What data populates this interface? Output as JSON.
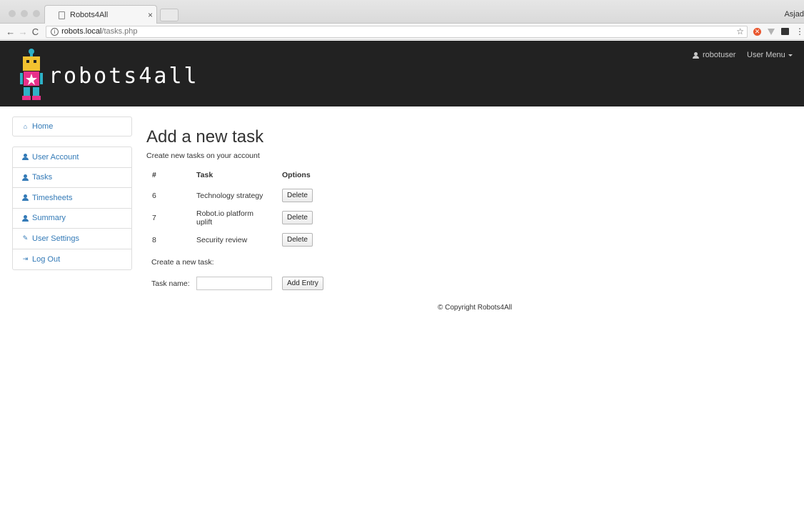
{
  "browser": {
    "tab_title": "Robots4All",
    "tab_close": "×",
    "profile": "Asjad",
    "url_host": "robots.local",
    "url_path": "/tasks.php",
    "back": "←",
    "forward": "→",
    "reload": "C",
    "star": "☆",
    "more": "⋮"
  },
  "header": {
    "brand": "robots4all",
    "username": "robotuser",
    "user_menu": "User Menu",
    "background": "#222222"
  },
  "sidebar": {
    "home": {
      "label": "Home",
      "icon": "home-icon"
    },
    "items": [
      {
        "label": "User Account",
        "icon": "user-icon"
      },
      {
        "label": "Tasks",
        "icon": "user-icon"
      },
      {
        "label": "Timesheets",
        "icon": "user-icon"
      },
      {
        "label": "Summary",
        "icon": "user-icon"
      },
      {
        "label": "User Settings",
        "icon": "edit-icon"
      },
      {
        "label": "Log Out",
        "icon": "logout-icon"
      }
    ],
    "link_color": "#337ab7"
  },
  "main": {
    "title": "Add a new task",
    "subtitle": "Create new tasks on your account",
    "table": {
      "headers": [
        "#",
        "Task",
        "Options"
      ],
      "rows": [
        {
          "id": "6",
          "task": "Technology strategy",
          "action": "Delete"
        },
        {
          "id": "7",
          "task": "Robot.io platform uplift",
          "action": "Delete"
        },
        {
          "id": "8",
          "task": "Security review",
          "action": "Delete"
        }
      ]
    },
    "new_task_label": "Create a new task:",
    "task_name_label": "Task name:",
    "task_name_value": "",
    "add_button": "Add Entry"
  },
  "footer": {
    "copyright": "© Copyright Robots4All"
  }
}
